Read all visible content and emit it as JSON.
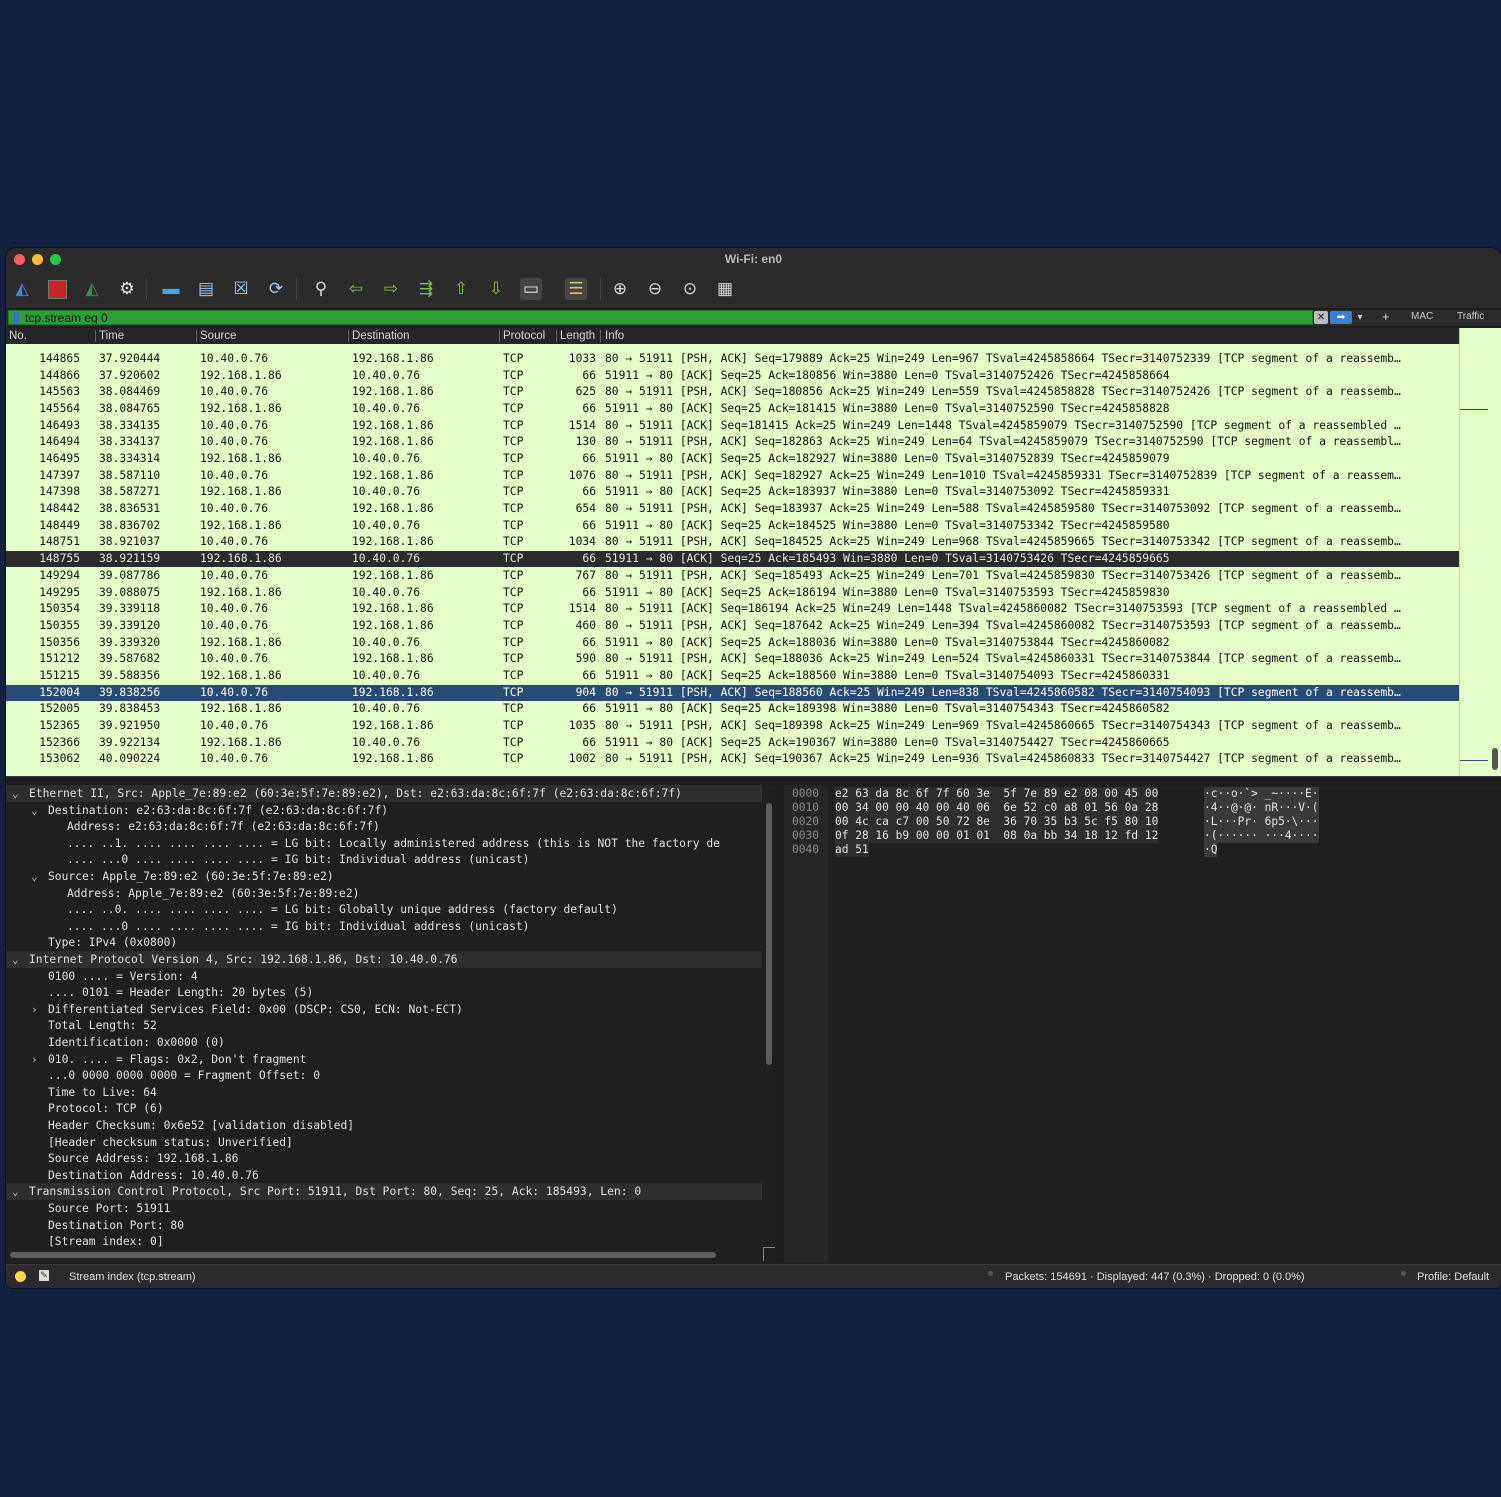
{
  "window": {
    "title": "Wi-Fi: en0"
  },
  "filter": {
    "value": "tcp.stream eq 0",
    "mac_label": "MAC",
    "traffic_label": "Traffic"
  },
  "columns": {
    "no": "No.",
    "time": "Time",
    "source": "Source",
    "destination": "Destination",
    "protocol": "Protocol",
    "length": "Length",
    "info": "Info"
  },
  "packets": [
    {
      "no": "144865",
      "time": "37.920444",
      "src": "10.40.0.76",
      "dst": "192.168.1.86",
      "proto": "TCP",
      "len": "1033",
      "info": "80 → 51911 [PSH, ACK] Seq=179889 Ack=25 Win=249 Len=967 TSval=4245858664 TSecr=3140752339 [TCP segment of a reassemb…"
    },
    {
      "no": "144866",
      "time": "37.920602",
      "src": "192.168.1.86",
      "dst": "10.40.0.76",
      "proto": "TCP",
      "len": "66",
      "info": "51911 → 80 [ACK] Seq=25 Ack=180856 Win=3880 Len=0 TSval=3140752426 TSecr=4245858664"
    },
    {
      "no": "145563",
      "time": "38.084469",
      "src": "10.40.0.76",
      "dst": "192.168.1.86",
      "proto": "TCP",
      "len": "625",
      "info": "80 → 51911 [PSH, ACK] Seq=180856 Ack=25 Win=249 Len=559 TSval=4245858828 TSecr=3140752426 [TCP segment of a reassemb…"
    },
    {
      "no": "145564",
      "time": "38.084765",
      "src": "192.168.1.86",
      "dst": "10.40.0.76",
      "proto": "TCP",
      "len": "66",
      "info": "51911 → 80 [ACK] Seq=25 Ack=181415 Win=3880 Len=0 TSval=3140752590 TSecr=4245858828"
    },
    {
      "no": "146493",
      "time": "38.334135",
      "src": "10.40.0.76",
      "dst": "192.168.1.86",
      "proto": "TCP",
      "len": "1514",
      "info": "80 → 51911 [ACK] Seq=181415 Ack=25 Win=249 Len=1448 TSval=4245859079 TSecr=3140752590 [TCP segment of a reassembled …"
    },
    {
      "no": "146494",
      "time": "38.334137",
      "src": "10.40.0.76",
      "dst": "192.168.1.86",
      "proto": "TCP",
      "len": "130",
      "info": "80 → 51911 [PSH, ACK] Seq=182863 Ack=25 Win=249 Len=64 TSval=4245859079 TSecr=3140752590 [TCP segment of a reassembl…"
    },
    {
      "no": "146495",
      "time": "38.334314",
      "src": "192.168.1.86",
      "dst": "10.40.0.76",
      "proto": "TCP",
      "len": "66",
      "info": "51911 → 80 [ACK] Seq=25 Ack=182927 Win=3880 Len=0 TSval=3140752839 TSecr=4245859079"
    },
    {
      "no": "147397",
      "time": "38.587110",
      "src": "10.40.0.76",
      "dst": "192.168.1.86",
      "proto": "TCP",
      "len": "1076",
      "info": "80 → 51911 [PSH, ACK] Seq=182927 Ack=25 Win=249 Len=1010 TSval=4245859331 TSecr=3140752839 [TCP segment of a reassem…"
    },
    {
      "no": "147398",
      "time": "38.587271",
      "src": "192.168.1.86",
      "dst": "10.40.0.76",
      "proto": "TCP",
      "len": "66",
      "info": "51911 → 80 [ACK] Seq=25 Ack=183937 Win=3880 Len=0 TSval=3140753092 TSecr=4245859331"
    },
    {
      "no": "148442",
      "time": "38.836531",
      "src": "10.40.0.76",
      "dst": "192.168.1.86",
      "proto": "TCP",
      "len": "654",
      "info": "80 → 51911 [PSH, ACK] Seq=183937 Ack=25 Win=249 Len=588 TSval=4245859580 TSecr=3140753092 [TCP segment of a reassemb…"
    },
    {
      "no": "148449",
      "time": "38.836702",
      "src": "192.168.1.86",
      "dst": "10.40.0.76",
      "proto": "TCP",
      "len": "66",
      "info": "51911 → 80 [ACK] Seq=25 Ack=184525 Win=3880 Len=0 TSval=3140753342 TSecr=4245859580"
    },
    {
      "no": "148751",
      "time": "38.921037",
      "src": "10.40.0.76",
      "dst": "192.168.1.86",
      "proto": "TCP",
      "len": "1034",
      "info": "80 → 51911 [PSH, ACK] Seq=184525 Ack=25 Win=249 Len=968 TSval=4245859665 TSecr=3140753342 [TCP segment of a reassemb…"
    },
    {
      "no": "148755",
      "time": "38.921159",
      "src": "192.168.1.86",
      "dst": "10.40.0.76",
      "proto": "TCP",
      "len": "66",
      "info": "51911 → 80 [ACK] Seq=25 Ack=185493 Win=3880 Len=0 TSval=3140753426 TSecr=4245859665",
      "style": "dark"
    },
    {
      "no": "149294",
      "time": "39.087786",
      "src": "10.40.0.76",
      "dst": "192.168.1.86",
      "proto": "TCP",
      "len": "767",
      "info": "80 → 51911 [PSH, ACK] Seq=185493 Ack=25 Win=249 Len=701 TSval=4245859830 TSecr=3140753426 [TCP segment of a reassemb…"
    },
    {
      "no": "149295",
      "time": "39.088075",
      "src": "192.168.1.86",
      "dst": "10.40.0.76",
      "proto": "TCP",
      "len": "66",
      "info": "51911 → 80 [ACK] Seq=25 Ack=186194 Win=3880 Len=0 TSval=3140753593 TSecr=4245859830"
    },
    {
      "no": "150354",
      "time": "39.339118",
      "src": "10.40.0.76",
      "dst": "192.168.1.86",
      "proto": "TCP",
      "len": "1514",
      "info": "80 → 51911 [ACK] Seq=186194 Ack=25 Win=249 Len=1448 TSval=4245860082 TSecr=3140753593 [TCP segment of a reassembled …"
    },
    {
      "no": "150355",
      "time": "39.339120",
      "src": "10.40.0.76",
      "dst": "192.168.1.86",
      "proto": "TCP",
      "len": "460",
      "info": "80 → 51911 [PSH, ACK] Seq=187642 Ack=25 Win=249 Len=394 TSval=4245860082 TSecr=3140753593 [TCP segment of a reassemb…"
    },
    {
      "no": "150356",
      "time": "39.339320",
      "src": "192.168.1.86",
      "dst": "10.40.0.76",
      "proto": "TCP",
      "len": "66",
      "info": "51911 → 80 [ACK] Seq=25 Ack=188036 Win=3880 Len=0 TSval=3140753844 TSecr=4245860082"
    },
    {
      "no": "151212",
      "time": "39.587682",
      "src": "10.40.0.76",
      "dst": "192.168.1.86",
      "proto": "TCP",
      "len": "590",
      "info": "80 → 51911 [PSH, ACK] Seq=188036 Ack=25 Win=249 Len=524 TSval=4245860331 TSecr=3140753844 [TCP segment of a reassemb…"
    },
    {
      "no": "151215",
      "time": "39.588356",
      "src": "192.168.1.86",
      "dst": "10.40.0.76",
      "proto": "TCP",
      "len": "66",
      "info": "51911 → 80 [ACK] Seq=25 Ack=188560 Win=3880 Len=0 TSval=3140754093 TSecr=4245860331"
    },
    {
      "no": "152004",
      "time": "39.838256",
      "src": "10.40.0.76",
      "dst": "192.168.1.86",
      "proto": "TCP",
      "len": "904",
      "info": "80 → 51911 [PSH, ACK] Seq=188560 Ack=25 Win=249 Len=838 TSval=4245860582 TSecr=3140754093 [TCP segment of a reassemb…",
      "style": "blue"
    },
    {
      "no": "152005",
      "time": "39.838453",
      "src": "192.168.1.86",
      "dst": "10.40.0.76",
      "proto": "TCP",
      "len": "66",
      "info": "51911 → 80 [ACK] Seq=25 Ack=189398 Win=3880 Len=0 TSval=3140754343 TSecr=4245860582"
    },
    {
      "no": "152365",
      "time": "39.921950",
      "src": "10.40.0.76",
      "dst": "192.168.1.86",
      "proto": "TCP",
      "len": "1035",
      "info": "80 → 51911 [PSH, ACK] Seq=189398 Ack=25 Win=249 Len=969 TSval=4245860665 TSecr=3140754343 [TCP segment of a reassemb…"
    },
    {
      "no": "152366",
      "time": "39.922134",
      "src": "192.168.1.86",
      "dst": "10.40.0.76",
      "proto": "TCP",
      "len": "66",
      "info": "51911 → 80 [ACK] Seq=25 Ack=190367 Win=3880 Len=0 TSval=3140754427 TSecr=4245860665"
    },
    {
      "no": "153062",
      "time": "40.090224",
      "src": "10.40.0.76",
      "dst": "192.168.1.86",
      "proto": "TCP",
      "len": "1002",
      "info": "80 → 51911 [PSH, ACK] Seq=190367 Ack=25 Win=249 Len=936 TSval=4245860833 TSecr=3140754427 [TCP segment of a reassemb…"
    }
  ],
  "details": [
    {
      "indent": 0,
      "arrow": "⌄",
      "header": true,
      "text": "Ethernet II, Src: Apple_7e:89:e2 (60:3e:5f:7e:89:e2), Dst: e2:63:da:8c:6f:7f (e2:63:da:8c:6f:7f)"
    },
    {
      "indent": 1,
      "arrow": "⌄",
      "text": "Destination: e2:63:da:8c:6f:7f (e2:63:da:8c:6f:7f)"
    },
    {
      "indent": 2,
      "arrow": "",
      "text": "Address: e2:63:da:8c:6f:7f (e2:63:da:8c:6f:7f)"
    },
    {
      "indent": 2,
      "arrow": "",
      "text": ".... ..1. .... .... .... .... = LG bit: Locally administered address (this is NOT the factory de"
    },
    {
      "indent": 2,
      "arrow": "",
      "text": ".... ...0 .... .... .... .... = IG bit: Individual address (unicast)"
    },
    {
      "indent": 1,
      "arrow": "⌄",
      "text": "Source: Apple_7e:89:e2 (60:3e:5f:7e:89:e2)"
    },
    {
      "indent": 2,
      "arrow": "",
      "text": "Address: Apple_7e:89:e2 (60:3e:5f:7e:89:e2)"
    },
    {
      "indent": 2,
      "arrow": "",
      "text": ".... ..0. .... .... .... .... = LG bit: Globally unique address (factory default)"
    },
    {
      "indent": 2,
      "arrow": "",
      "text": ".... ...0 .... .... .... .... = IG bit: Individual address (unicast)"
    },
    {
      "indent": 1,
      "arrow": "",
      "text": "Type: IPv4 (0x0800)"
    },
    {
      "indent": 0,
      "arrow": "⌄",
      "header": true,
      "text": "Internet Protocol Version 4, Src: 192.168.1.86, Dst: 10.40.0.76"
    },
    {
      "indent": 1,
      "arrow": "",
      "text": "0100 .... = Version: 4"
    },
    {
      "indent": 1,
      "arrow": "",
      "text": ".... 0101 = Header Length: 20 bytes (5)"
    },
    {
      "indent": 1,
      "arrow": "›",
      "text": "Differentiated Services Field: 0x00 (DSCP: CS0, ECN: Not-ECT)"
    },
    {
      "indent": 1,
      "arrow": "",
      "text": "Total Length: 52"
    },
    {
      "indent": 1,
      "arrow": "",
      "text": "Identification: 0x0000 (0)"
    },
    {
      "indent": 1,
      "arrow": "›",
      "text": "010. .... = Flags: 0x2, Don't fragment"
    },
    {
      "indent": 1,
      "arrow": "",
      "text": "...0 0000 0000 0000 = Fragment Offset: 0"
    },
    {
      "indent": 1,
      "arrow": "",
      "text": "Time to Live: 64"
    },
    {
      "indent": 1,
      "arrow": "",
      "text": "Protocol: TCP (6)"
    },
    {
      "indent": 1,
      "arrow": "",
      "text": "Header Checksum: 0x6e52 [validation disabled]"
    },
    {
      "indent": 1,
      "arrow": "",
      "text": "[Header checksum status: Unverified]"
    },
    {
      "indent": 1,
      "arrow": "",
      "text": "Source Address: 192.168.1.86"
    },
    {
      "indent": 1,
      "arrow": "",
      "text": "Destination Address: 10.40.0.76"
    },
    {
      "indent": 0,
      "arrow": "⌄",
      "header": true,
      "text": "Transmission Control Protocol, Src Port: 51911, Dst Port: 80, Seq: 25, Ack: 185493, Len: 0"
    },
    {
      "indent": 1,
      "arrow": "",
      "text": "Source Port: 51911"
    },
    {
      "indent": 1,
      "arrow": "",
      "text": "Destination Port: 80"
    },
    {
      "indent": 1,
      "arrow": "",
      "text": "[Stream index: 0]"
    }
  ],
  "bytes": [
    {
      "off": "0000",
      "hex": "e2 63 da 8c 6f 7f 60 3e  5f 7e 89 e2 08 00 45 00",
      "ascii": "·c··o·`> _~····E·"
    },
    {
      "off": "0010",
      "hex": "00 34 00 00 40 00 40 06  6e 52 c0 a8 01 56 0a 28",
      "ascii": "·4··@·@· nR···V·("
    },
    {
      "off": "0020",
      "hex": "00 4c ca c7 00 50 72 8e  36 70 35 b3 5c f5 80 10",
      "ascii": "·L···Pr· 6p5·\\···"
    },
    {
      "off": "0030",
      "hex": "0f 28 16 b9 00 00 01 01  08 0a bb 34 18 12 fd 12",
      "ascii": "·(······ ···4····"
    },
    {
      "off": "0040",
      "hex": "ad 51",
      "ascii": "·Q"
    }
  ],
  "status": {
    "field": "Stream index (tcp.stream)",
    "packets": "Packets: 154691 · Displayed: 447 (0.3%) · Dropped: 0 (0.0%)",
    "profile": "Profile: Default"
  },
  "toolbar_icons": [
    "shark-fin-start-icon",
    "stop-capture-icon",
    "restart-capture-icon",
    "capture-options-icon",
    "open-file-icon",
    "save-file-icon",
    "close-file-icon",
    "reload-file-icon",
    "find-packet-icon",
    "go-back-icon",
    "go-forward-icon",
    "go-to-packet-icon",
    "first-packet-icon",
    "last-packet-icon",
    "autoscroll-icon",
    "colorize-icon",
    "zoom-in-icon",
    "zoom-out-icon",
    "normal-size-icon",
    "resize-columns-icon"
  ]
}
